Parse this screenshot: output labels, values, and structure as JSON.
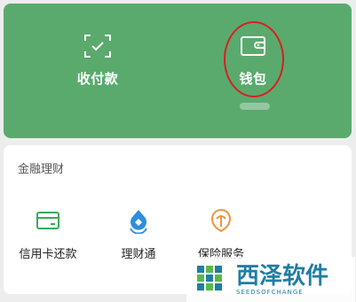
{
  "top": {
    "pay_label": "收付款",
    "wallet_label": "钱包"
  },
  "finance": {
    "section_title": "金融理财",
    "services": [
      {
        "label": "信用卡还款",
        "icon": "credit-card-icon",
        "color": "#3ea85a"
      },
      {
        "label": "理财通",
        "icon": "licaitong-icon",
        "color": "#2f8ee0"
      },
      {
        "label": "保险服务",
        "icon": "insurance-icon",
        "color": "#f0953a"
      }
    ]
  },
  "watermark": {
    "title": "西泽软件",
    "subtitle": "SEEDSOFCHANGE"
  },
  "colors": {
    "accent_green": "#5aaa6e",
    "annotation_red": "#d82020",
    "watermark_blue": "#1f7ea4"
  }
}
